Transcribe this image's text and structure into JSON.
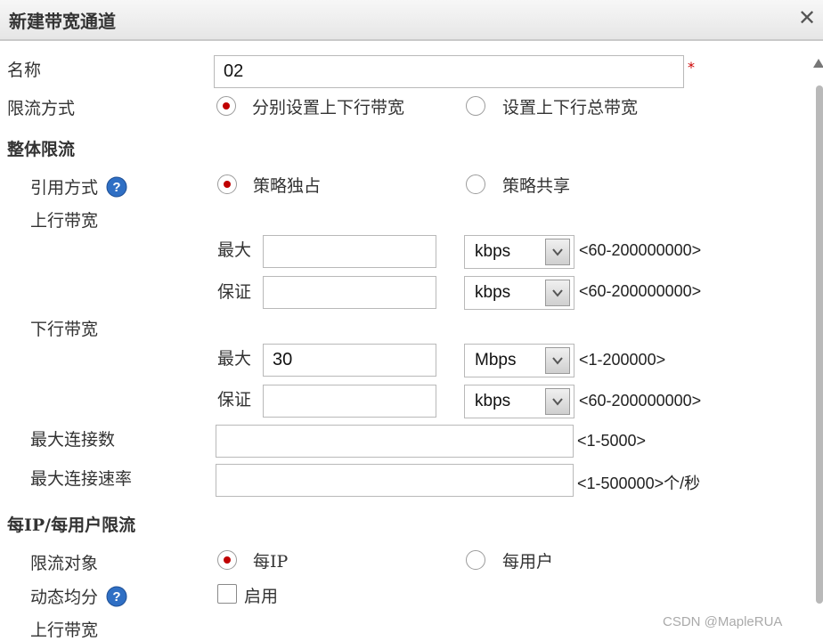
{
  "dialog": {
    "title": "新建带宽通道"
  },
  "form": {
    "name_label": "名称",
    "name_value": "02",
    "required_mark": "*",
    "limit_mode_label": "限流方式",
    "limit_mode_options": [
      "分别设置上下行带宽",
      "设置上下行总带宽"
    ],
    "limit_mode_selected": 0
  },
  "overall": {
    "section_title": "整体限流",
    "ref_mode_label": "引用方式",
    "ref_mode_options": [
      "策略独占",
      "策略共享"
    ],
    "ref_mode_selected": 0,
    "upstream_label": "上行带宽",
    "up_max_label": "最大",
    "up_max_value": "",
    "up_max_unit": "kbps",
    "up_max_range": "<60-200000000>",
    "up_guar_label": "保证",
    "up_guar_value": "",
    "up_guar_unit": "kbps",
    "up_guar_range": "<60-200000000>",
    "downstream_label": "下行带宽",
    "down_max_label": "最大",
    "down_max_value": "30",
    "down_max_unit": "Mbps",
    "down_max_range": "<1-200000>",
    "down_guar_label": "保证",
    "down_guar_value": "",
    "down_guar_unit": "kbps",
    "down_guar_range": "<60-200000000>",
    "max_conn_label": "最大连接数",
    "max_conn_value": "",
    "max_conn_range": "<1-5000>",
    "max_conn_rate_label": "最大连接速率",
    "max_conn_rate_value": "",
    "max_conn_rate_range": "<1-500000>个/秒"
  },
  "per_ip": {
    "section_title": "每IP/每用户限流",
    "target_label": "限流对象",
    "target_options": [
      "每IP",
      "每用户"
    ],
    "target_selected": 0,
    "dynamic_label": "动态均分",
    "dynamic_option": "启用",
    "dynamic_checked": false,
    "upstream_label": "上行带宽"
  },
  "watermark": "CSDN @MapleRUA",
  "icons": {
    "close": "close-icon",
    "help": "help-icon",
    "dropdown": "chevron-down-icon"
  },
  "colors": {
    "radio_dot": "#c00000",
    "required": "#cc0000",
    "help_icon": "#2f6fc4"
  }
}
